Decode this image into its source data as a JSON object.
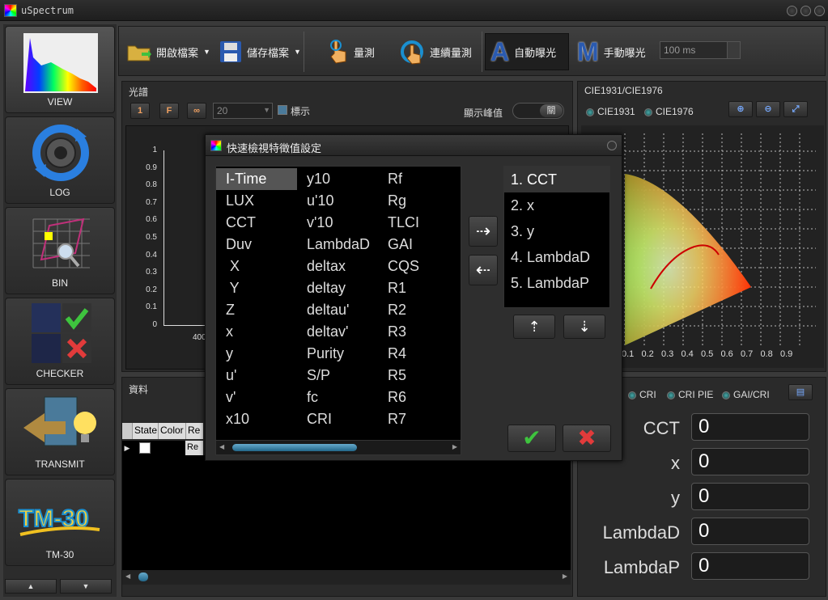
{
  "app": {
    "title": "uSpectrum"
  },
  "nav": [
    {
      "label": "VIEW",
      "icon": "spectrum-view-icon"
    },
    {
      "label": "LOG",
      "icon": "refresh-log-icon"
    },
    {
      "label": "BIN",
      "icon": "bin-grid-icon"
    },
    {
      "label": "CHECKER",
      "icon": "checker-icon"
    },
    {
      "label": "TRANSMIT",
      "icon": "transmit-icon"
    },
    {
      "label": "TM-30",
      "icon": "tm30-icon"
    }
  ],
  "toolbar": {
    "open_label": "開啟檔案",
    "save_label": "儲存檔案",
    "measure_label": "量測",
    "continuous_label": "連續量測",
    "auto_exposure_label": "自動曝光",
    "manual_exposure_label": "手動曝光",
    "auto_letter": "A",
    "manual_letter": "M",
    "exposure_value": "100 ms"
  },
  "spectrum": {
    "title": "光譜",
    "btn1": "1",
    "btnF": "F",
    "btnInf": "∞",
    "count_value": "20",
    "label_checkbox": "標示",
    "show_peak_label": "顯示峰值",
    "toggle_state": "關",
    "y_ticks": [
      "1",
      "0.9",
      "0.8",
      "0.7",
      "0.6",
      "0.5",
      "0.4",
      "0.3",
      "0.2",
      "0.1",
      "0"
    ],
    "x_tick_first": "400"
  },
  "cie": {
    "title": "CIE1931/CIE1976",
    "option1": "CIE1931",
    "option2": "CIE1976",
    "x_ticks": [
      "0.1",
      "0.2",
      "0.3",
      "0.4",
      "0.5",
      "0.6",
      "0.7",
      "0.8",
      "0.9"
    ]
  },
  "data_panel": {
    "title": "資料",
    "columns": [
      "State",
      "Color",
      "Re"
    ],
    "row_cell": "Re"
  },
  "cri_panel": {
    "tabs": [
      "CRI",
      "CRI PIE",
      "GAI/CRI"
    ],
    "rows": [
      {
        "key": "CCT",
        "value": "0"
      },
      {
        "key": "x",
        "value": "0"
      },
      {
        "key": "y",
        "value": "0"
      },
      {
        "key": "LambdaD",
        "value": "0"
      },
      {
        "key": "LambdaP",
        "value": "0"
      }
    ]
  },
  "dialog": {
    "title": "快速檢視特徵值設定",
    "col1": [
      "I-Time",
      "LUX",
      "CCT",
      "Duv",
      " X",
      " Y",
      "Z",
      "x",
      "y",
      "u'",
      "v'",
      "x10"
    ],
    "col2": [
      "y10",
      "u'10",
      "v'10",
      "LambdaD",
      "deltax",
      "deltay",
      "deltau'",
      "deltav'",
      "Purity",
      "S/P",
      "fc",
      "CRI"
    ],
    "col3": [
      "Rf",
      "Rg",
      "TLCI",
      "GAI",
      "CQS",
      "R1",
      "R2",
      "R3",
      "R4",
      "R5",
      "R6",
      "R7"
    ],
    "selected": [
      "1. CCT",
      "2. x",
      "3. y",
      "4. LambdaD",
      "5. LambdaP"
    ]
  }
}
